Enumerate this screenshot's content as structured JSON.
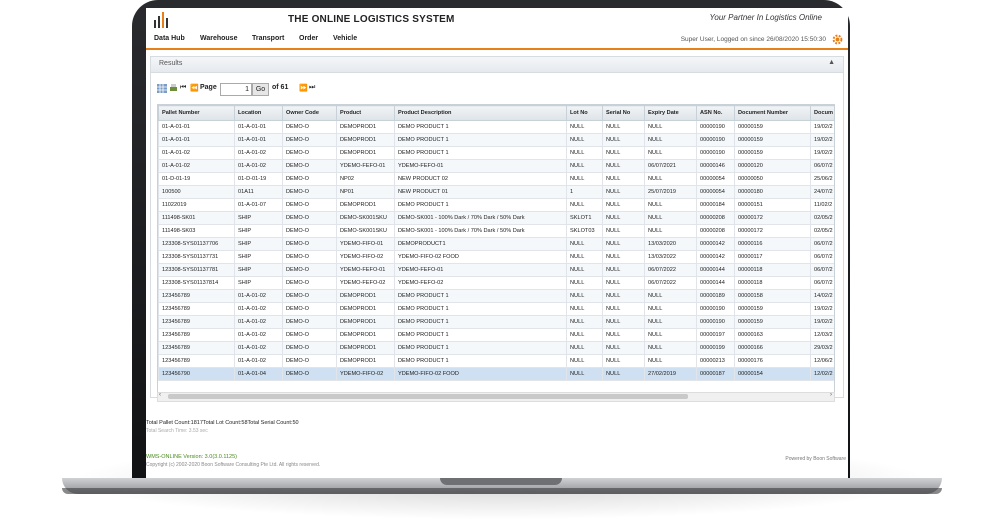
{
  "app": {
    "title": "THE ONLINE LOGISTICS SYSTEM",
    "tagline": "Your Partner In Logistics Online",
    "user_info": "Super User, Logged on since 26/08/2020 15:50:30"
  },
  "nav": {
    "items": [
      "Data Hub",
      "Warehouse",
      "Transport",
      "Order",
      "Vehicle"
    ]
  },
  "panel": {
    "title": "Results",
    "collapse_icon": "chevron-up-icon"
  },
  "pager": {
    "page_label": "Page",
    "page_value": "1",
    "go_label": "Go",
    "of_label": "of 61"
  },
  "table": {
    "columns": [
      "Pallet Number",
      "Location",
      "Owner Code",
      "Product",
      "Product Description",
      "Lot No",
      "Serial No",
      "Expiry Date",
      "ASN No.",
      "Document Number",
      "Docum"
    ],
    "rows": [
      [
        "01-A-01-01",
        "01-A-01-01",
        "DEMO-O",
        "DEMOPROD1",
        "DEMO PRODUCT 1",
        "NULL",
        "NULL",
        "NULL",
        "00000190",
        "00000159",
        "19/02/2"
      ],
      [
        "01-A-01-01",
        "01-A-01-01",
        "DEMO-O",
        "DEMOPROD1",
        "DEMO PRODUCT 1",
        "NULL",
        "NULL",
        "NULL",
        "00000190",
        "00000159",
        "19/02/2"
      ],
      [
        "01-A-01-02",
        "01-A-01-02",
        "DEMO-O",
        "DEMOPROD1",
        "DEMO PRODUCT 1",
        "NULL",
        "NULL",
        "NULL",
        "00000190",
        "00000159",
        "19/02/2"
      ],
      [
        "01-A-01-02",
        "01-A-01-02",
        "DEMO-O",
        "YDEMO-FEFO-01",
        "YDEMO-FEFO-01",
        "NULL",
        "NULL",
        "06/07/2021",
        "00000146",
        "00000120",
        "06/07/2"
      ],
      [
        "01-D-01-19",
        "01-D-01-19",
        "DEMO-O",
        "NP02",
        "NEW PRODUCT 02",
        "NULL",
        "NULL",
        "NULL",
        "00000054",
        "00000050",
        "25/06/2"
      ],
      [
        "100500",
        "01A11",
        "DEMO-O",
        "NP01",
        "NEW PRODUCT 01",
        "1",
        "NULL",
        "25/07/2019",
        "00000054",
        "00000180",
        "24/07/2"
      ],
      [
        "11022019",
        "01-A-01-07",
        "DEMO-O",
        "DEMOPROD1",
        "DEMO PRODUCT 1",
        "NULL",
        "NULL",
        "NULL",
        "00000184",
        "00000151",
        "11/02/2"
      ],
      [
        "111498-SK01",
        "SHIP",
        "DEMO-O",
        "DEMO-SK001SKU",
        "DEMO-SK001 - 100% Dark / 70% Dark / 50% Dark",
        "SKLOT1",
        "NULL",
        "NULL",
        "00000208",
        "00000172",
        "02/05/2"
      ],
      [
        "111498-SK03",
        "SHIP",
        "DEMO-O",
        "DEMO-SK001SKU",
        "DEMO-SK001 - 100% Dark / 70% Dark / 50% Dark",
        "SKLOT03",
        "NULL",
        "NULL",
        "00000208",
        "00000172",
        "02/05/2"
      ],
      [
        "123308-SYS01137706",
        "SHIP",
        "DEMO-O",
        "YDEMO-FIFO-01",
        "DEMOPRODUCT1",
        "NULL",
        "NULL",
        "13/03/2020",
        "00000142",
        "00000116",
        "06/07/2"
      ],
      [
        "123308-SYS01137731",
        "SHIP",
        "DEMO-O",
        "YDEMO-FIFO-02",
        "YDEMO-FIFO-02 FOOD",
        "NULL",
        "NULL",
        "13/03/2022",
        "00000142",
        "00000117",
        "06/07/2"
      ],
      [
        "123308-SYS01137781",
        "SHIP",
        "DEMO-O",
        "YDEMO-FEFO-01",
        "YDEMO-FEFO-01",
        "NULL",
        "NULL",
        "06/07/2022",
        "00000144",
        "00000118",
        "06/07/2"
      ],
      [
        "123308-SYS01137814",
        "SHIP",
        "DEMO-O",
        "YDEMO-FEFO-02",
        "YDEMO-FEFO-02",
        "NULL",
        "NULL",
        "06/07/2022",
        "00000144",
        "00000118",
        "06/07/2"
      ],
      [
        "123456789",
        "01-A-01-02",
        "DEMO-O",
        "DEMOPROD1",
        "DEMO PRODUCT 1",
        "NULL",
        "NULL",
        "NULL",
        "00000189",
        "00000158",
        "14/02/2"
      ],
      [
        "123456789",
        "01-A-01-02",
        "DEMO-O",
        "DEMOPROD1",
        "DEMO PRODUCT 1",
        "NULL",
        "NULL",
        "NULL",
        "00000190",
        "00000159",
        "19/02/2"
      ],
      [
        "123456789",
        "01-A-01-02",
        "DEMO-O",
        "DEMOPROD1",
        "DEMO PRODUCT 1",
        "NULL",
        "NULL",
        "NULL",
        "00000190",
        "00000159",
        "19/02/2"
      ],
      [
        "123456789",
        "01-A-01-02",
        "DEMO-O",
        "DEMOPROD1",
        "DEMO PRODUCT 1",
        "NULL",
        "NULL",
        "NULL",
        "00000197",
        "00000163",
        "12/03/2"
      ],
      [
        "123456789",
        "01-A-01-02",
        "DEMO-O",
        "DEMOPROD1",
        "DEMO PRODUCT 1",
        "NULL",
        "NULL",
        "NULL",
        "00000199",
        "00000166",
        "29/03/2"
      ],
      [
        "123456789",
        "01-A-01-02",
        "DEMO-O",
        "DEMOPROD1",
        "DEMO PRODUCT 1",
        "NULL",
        "NULL",
        "NULL",
        "00000213",
        "00000176",
        "12/06/2"
      ],
      [
        "123456790",
        "01-A-01-04",
        "DEMO-O",
        "YDEMO-FIFO-02",
        "YDEMO-FIFO-02 FOOD",
        "NULL",
        "NULL",
        "27/02/2019",
        "00000187",
        "00000154",
        "12/02/2"
      ]
    ],
    "selected_row": 19
  },
  "footer": {
    "totals": "Total Pallet Count:1817Total Lot Count:58Total Serial Count:50",
    "search_time": "Total Search Time: 3.53 sec",
    "version": "WMS-ONLINE Version: 3.0(3.0.1125)",
    "copyright": "Copyright (c) 2002-2020 Boon Software Consulting Pte Ltd. All rights reserved.",
    "powered_by": "Powered by Boon Software"
  },
  "colors": {
    "accent": "#e8801a",
    "selected_row": "#cfe0f2"
  }
}
